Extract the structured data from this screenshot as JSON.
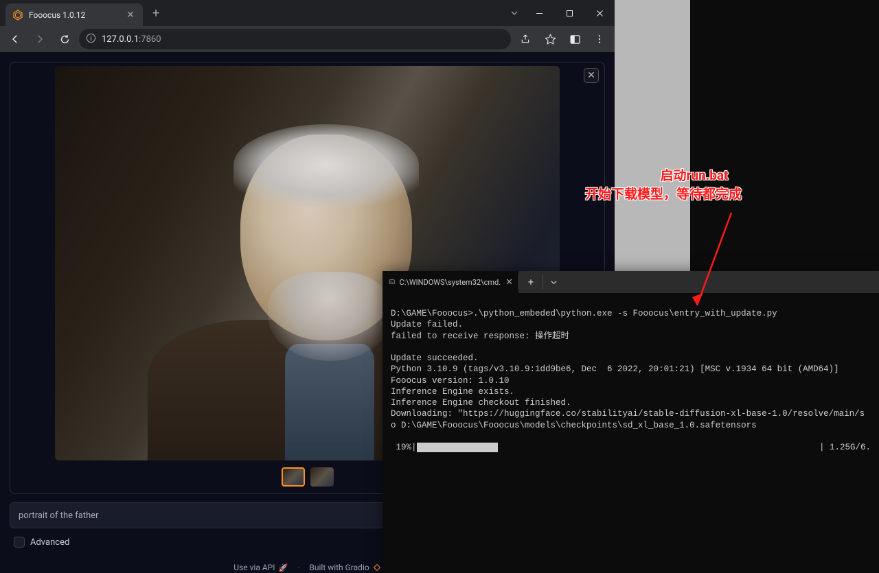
{
  "browser": {
    "tab": {
      "title": "Fooocus 1.0.12"
    },
    "address": {
      "host": "127.0.0.1",
      "port": ":7860"
    }
  },
  "app": {
    "prompt": "portrait of the father",
    "advanced_label": "Advanced",
    "footer_api": "Use via API",
    "footer_built": "Built with Gradio"
  },
  "terminal": {
    "tab_title": "C:\\WINDOWS\\system32\\cmd.",
    "lines": [
      "D:\\GAME\\Fooocus>.\\python_embeded\\python.exe -s Fooocus\\entry_with_update.py",
      "Update failed.",
      "failed to receive response: 操作超时",
      "",
      "Update succeeded.",
      "Python 3.10.9 (tags/v3.10.9:1dd9be6, Dec  6 2022, 20:01:21) [MSC v.1934 64 bit (AMD64)]",
      "Fooocus version: 1.0.10",
      "Inference Engine exists.",
      "Inference Engine checkout finished.",
      "Downloading: \"https://huggingface.co/stabilityai/stable-diffusion-xl-base-1.0/resolve/main/s",
      "o D:\\GAME\\Fooocus\\Fooocus\\models\\checkpoints\\sd_xl_base_1.0.safetensors"
    ],
    "progress_pct": " 19%|",
    "progress_tail": "| 1.25G/6."
  },
  "annotation": {
    "line1": "启动run.bat",
    "line2": "开始下载模型，等待都完成"
  }
}
